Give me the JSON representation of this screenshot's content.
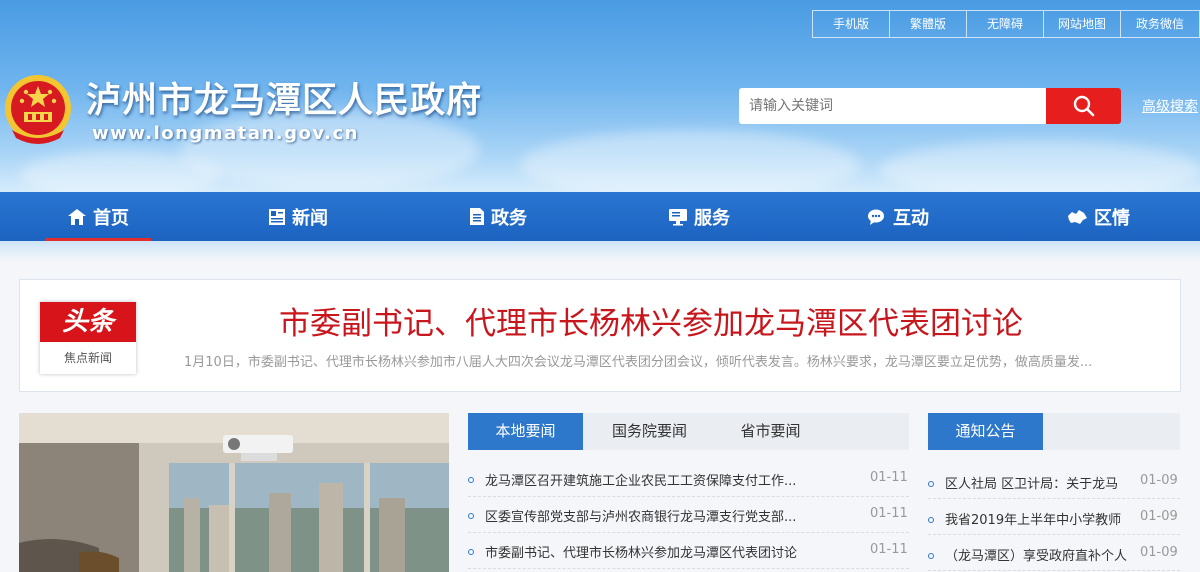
{
  "header": {
    "top_links": [
      "手机版",
      "繁體版",
      "无障碍",
      "网站地图",
      "政务微信"
    ],
    "site_title": "泸州市龙马潭区人民政府",
    "site_url": "www.longmatan.gov.cn",
    "search": {
      "placeholder": "请输入关键词",
      "advanced_label": "高级搜索"
    }
  },
  "nav": {
    "items": [
      {
        "label": "首页",
        "icon": "home-icon"
      },
      {
        "label": "新闻",
        "icon": "newspaper-icon"
      },
      {
        "label": "政务",
        "icon": "document-icon"
      },
      {
        "label": "服务",
        "icon": "monitor-icon"
      },
      {
        "label": "互动",
        "icon": "chat-icon"
      },
      {
        "label": "区情",
        "icon": "map-icon"
      }
    ],
    "active_index": 0
  },
  "headline": {
    "badge_top": "头条",
    "badge_bottom": "焦点新闻",
    "title": "市委副书记、代理市长杨林兴参加龙马潭区代表团讨论",
    "summary": "1月10日，市委副书记、代理市长杨林兴参加市八届人大四次会议龙马潭区代表团分团会议，倾听代表发言。杨林兴要求，龙马潭区要立足优势，做高质量发..."
  },
  "news": {
    "tabs": [
      "本地要闻",
      "国务院要闻",
      "省市要闻"
    ],
    "active_tab": 0,
    "items": [
      {
        "title": "龙马潭区召开建筑施工企业农民工工资保障支付工作...",
        "date": "01-11"
      },
      {
        "title": "区委宣传部党支部与泸州农商银行龙马潭支行党支部...",
        "date": "01-11"
      },
      {
        "title": "市委副书记、代理市长杨林兴参加龙马潭区代表团讨论",
        "date": "01-11"
      }
    ]
  },
  "notices": {
    "tab": "通知公告",
    "items": [
      {
        "title": "区人社局 区卫计局：关于龙马",
        "date": "01-09"
      },
      {
        "title": "我省2019年上半年中小学教师",
        "date": "01-09"
      },
      {
        "title": "（龙马潭区）享受政府直补个人",
        "date": "01-09"
      }
    ]
  },
  "colors": {
    "nav_blue": "#1c63c0",
    "accent_red": "#e61e1e",
    "tab_blue": "#2e78cc"
  }
}
